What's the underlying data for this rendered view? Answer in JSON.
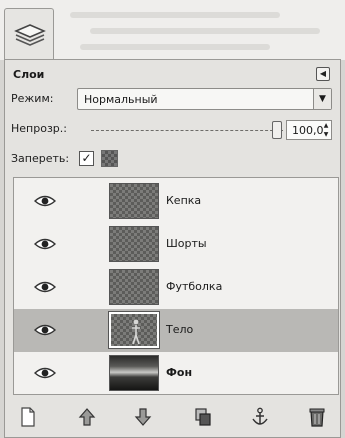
{
  "panel": {
    "title": "Слои",
    "mode_label": "Режим:",
    "mode_value": "Нормальный",
    "opacity_label": "Непрозр.:",
    "opacity_value": "100,0",
    "opacity_fraction": 1.0,
    "lock_label": "Запереть:",
    "lock_pixels_checked": true,
    "icons": {
      "tab": "layers-tab-icon",
      "menu": "panel-menu-arrow-icon",
      "mode_dropdown": "chevron-down-icon"
    }
  },
  "layers": [
    {
      "name": "Кепка",
      "visible": true,
      "selected": false,
      "thumb": "checker",
      "bold": false
    },
    {
      "name": "Шорты",
      "visible": true,
      "selected": false,
      "thumb": "checker",
      "bold": false
    },
    {
      "name": "Футболка",
      "visible": true,
      "selected": false,
      "thumb": "checker",
      "bold": false
    },
    {
      "name": "Тело",
      "visible": true,
      "selected": true,
      "thumb": "figure",
      "bold": false
    },
    {
      "name": "Фон",
      "visible": true,
      "selected": false,
      "thumb": "photo",
      "bold": true
    }
  ],
  "toolbar": [
    {
      "icon": "new-layer-icon"
    },
    {
      "icon": "raise-layer-icon"
    },
    {
      "icon": "lower-layer-icon"
    },
    {
      "icon": "duplicate-layer-icon"
    },
    {
      "icon": "anchor-layer-icon"
    },
    {
      "icon": "delete-layer-icon"
    }
  ]
}
